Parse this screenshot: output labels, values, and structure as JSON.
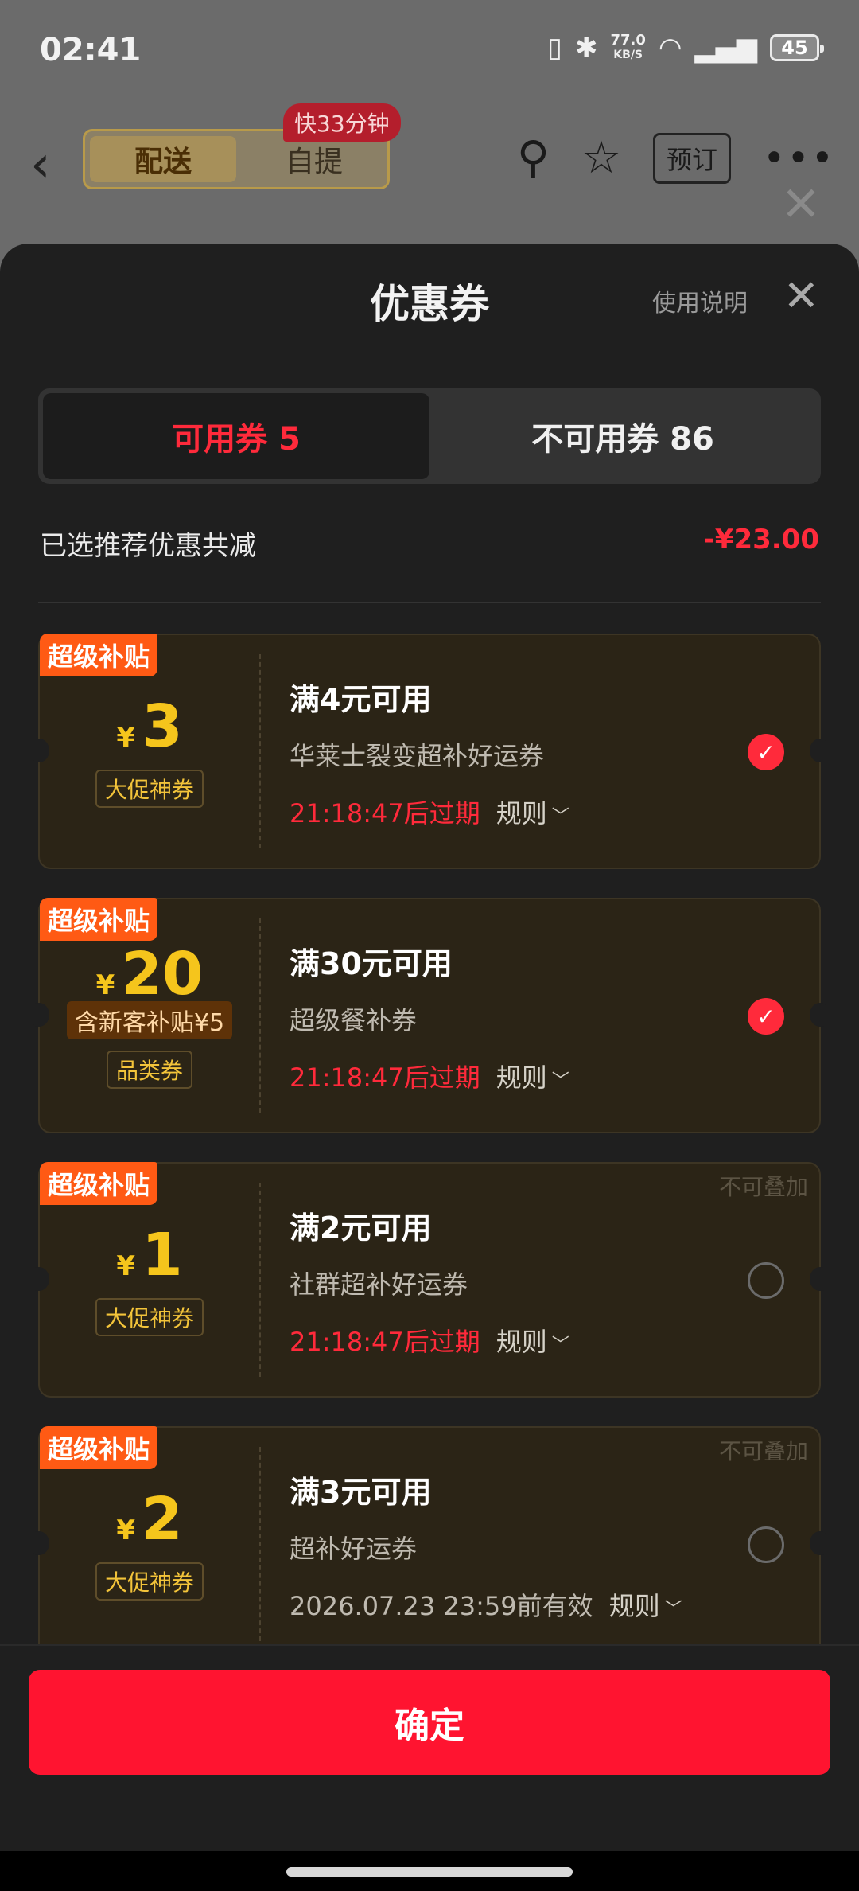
{
  "status_bar": {
    "time": "02:41",
    "net_speed_value": "77.0",
    "net_speed_unit": "KB/S",
    "battery": "45",
    "icons": [
      "vibrate-icon",
      "bluetooth-icon",
      "wifi-icon",
      "4g-signal-icon"
    ]
  },
  "nav": {
    "modes": [
      "配送",
      "自提"
    ],
    "fast_badge": "快33分钟",
    "reserve_label": "预订"
  },
  "sheet": {
    "title": "优惠券",
    "help_label": "使用说明",
    "tabs": [
      {
        "label": "可用券 5",
        "active": true
      },
      {
        "label": "不可用券 86",
        "active": false
      }
    ],
    "summary": {
      "label": "已选推荐优惠共减",
      "amount": "-¥23.00"
    },
    "coupons": [
      {
        "tag": "超级补贴",
        "currency": "¥",
        "value": "3",
        "type": "大促神券",
        "title": "满4元可用",
        "desc": "华莱士裂变超补好运券",
        "expire": "21:18:47后过期",
        "rule": "规则",
        "selected": true
      },
      {
        "tag": "超级补贴",
        "currency": "¥",
        "value": "20",
        "newbie": "含新客补贴¥5",
        "type": "品类券",
        "title": "满30元可用",
        "desc": "超级餐补券",
        "expire": "21:18:47后过期",
        "rule": "规则",
        "selected": true
      },
      {
        "tag": "超级补贴",
        "currency": "¥",
        "value": "1",
        "type": "大促神券",
        "title": "满2元可用",
        "desc": "社群超补好运券",
        "expire": "21:18:47后过期",
        "rule": "规则",
        "stack_note": "不可叠加",
        "selected": false
      },
      {
        "tag": "超级补贴",
        "currency": "¥",
        "value": "2",
        "type": "大促神券",
        "title": "满3元可用",
        "desc": "超补好运券",
        "expire": "2026.07.23 23:59前有效",
        "rule": "规则",
        "stack_note": "不可叠加",
        "selected": false
      }
    ],
    "confirm_label": "确定"
  }
}
